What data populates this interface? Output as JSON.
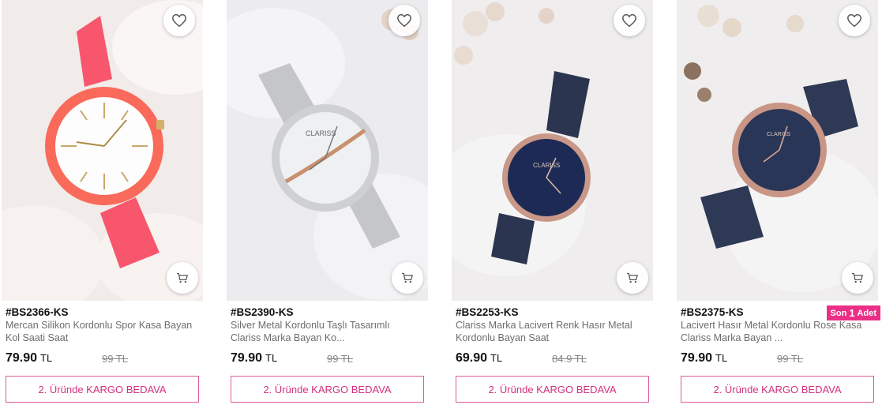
{
  "products": [
    {
      "code": "#BS2366-KS",
      "name": "Mercan Silikon Kordonlu Spor Kasa Bayan Kol Saati Saat",
      "price": "79.90",
      "currency": "TL",
      "old_price": "99 TL",
      "shipping_cta": "2. Üründe KARGO BEDAVA",
      "strap_color": "#f9576e",
      "dial_color": "#fdfdfd"
    },
    {
      "code": "#BS2390-KS",
      "name": "Silver Metal Kordonlu Taşlı Tasarımlı Clariss Marka Bayan Ko...",
      "price": "79.90",
      "currency": "TL",
      "old_price": "99 TL",
      "shipping_cta": "2. Üründe KARGO BEDAVA",
      "brand": "CLARISS",
      "strap_color": "#c9cacc",
      "dial_color": "#eef0f2"
    },
    {
      "code": "#BS2253-KS",
      "name": "Clariss Marka Lacivert Renk Hasır Metal Kordonlu Bayan Saat",
      "price": "69.90",
      "currency": "TL",
      "old_price": "84.9 TL",
      "shipping_cta": "2. Üründe KARGO BEDAVA",
      "brand": "CLARISS",
      "strap_color": "#2b3550",
      "dial_color": "#1d2a55"
    },
    {
      "code": "#BS2375-KS",
      "name": "Lacivert Hasır Metal Kordonlu Rose Kasa Clariss Marka Bayan ...",
      "price": "79.90",
      "currency": "TL",
      "old_price": "99 TL",
      "shipping_cta": "2. Üründe KARGO BEDAVA",
      "brand": "CLARISS",
      "stock_badge": {
        "prefix": "Son",
        "count": "1",
        "suffix": "Adet"
      },
      "strap_color": "#2d3955",
      "dial_color": "#2a3658"
    }
  ],
  "icons": {
    "favorite": "heart-icon",
    "cart": "cart-icon"
  },
  "colors": {
    "accent": "#ec2f86",
    "cta_border": "#e05a9b",
    "cta_text": "#d2317f"
  }
}
